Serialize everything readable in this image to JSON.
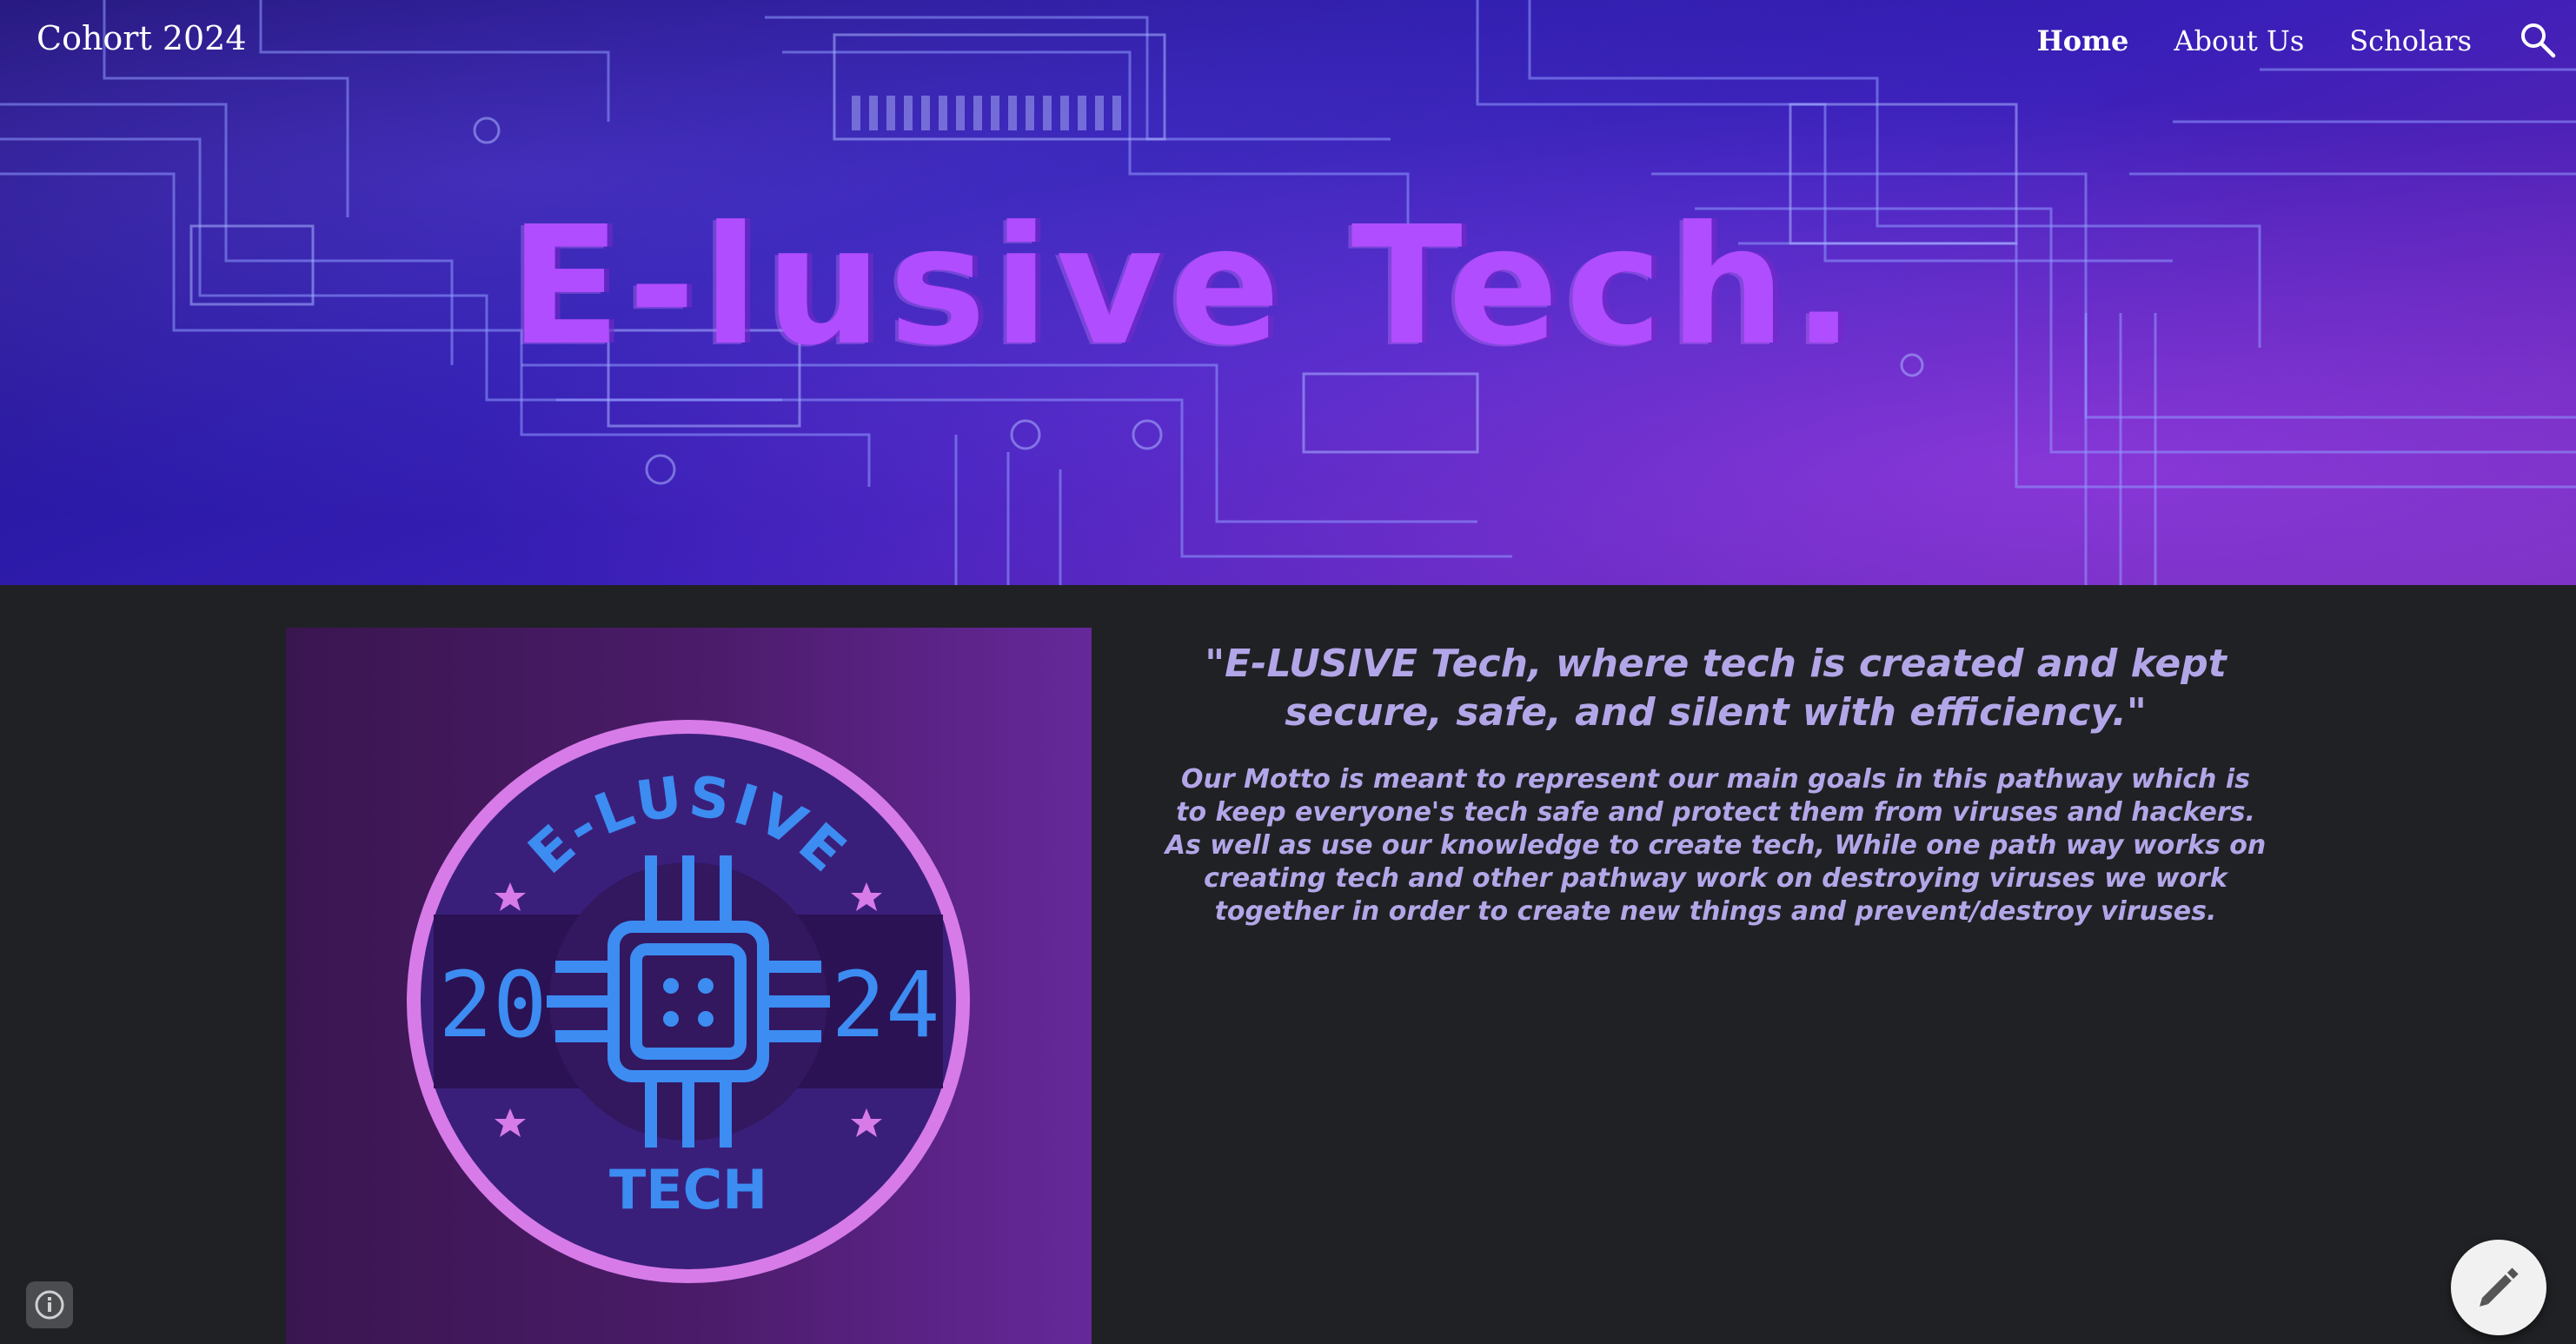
{
  "header": {
    "site_title": "Cohort 2024",
    "nav": [
      {
        "label": "Home",
        "active": true
      },
      {
        "label": "About Us",
        "active": false
      },
      {
        "label": "Scholars",
        "active": false
      }
    ],
    "search_icon": "search-icon"
  },
  "hero": {
    "title": "E-lusive Tech."
  },
  "logo": {
    "top_text": "E-LUSIVE",
    "bottom_text": "TECH",
    "year_left": "20",
    "year_right": "24"
  },
  "main": {
    "motto": "\"E-LUSIVE  Tech, where tech is created and kept secure, safe, and silent with efficiency.\"",
    "description": "Our Motto is meant to represent our main goals in this pathway which is to keep     everyone's tech safe and protect them from viruses and hackers. As well as  use  our knowledge to create tech, While one path way works on creating tech  and other  pathway work on  destroying viruses  we work together in order to create  new things and prevent/destroy viruses."
  },
  "controls": {
    "info_icon": "info-icon",
    "edit_icon": "pencil-icon"
  },
  "colors": {
    "page_bg": "#202124",
    "hero_title": "#b04dff",
    "body_text": "#b3a6e8",
    "logo_ring": "#d77be8",
    "logo_chip": "#3c8cf2"
  }
}
